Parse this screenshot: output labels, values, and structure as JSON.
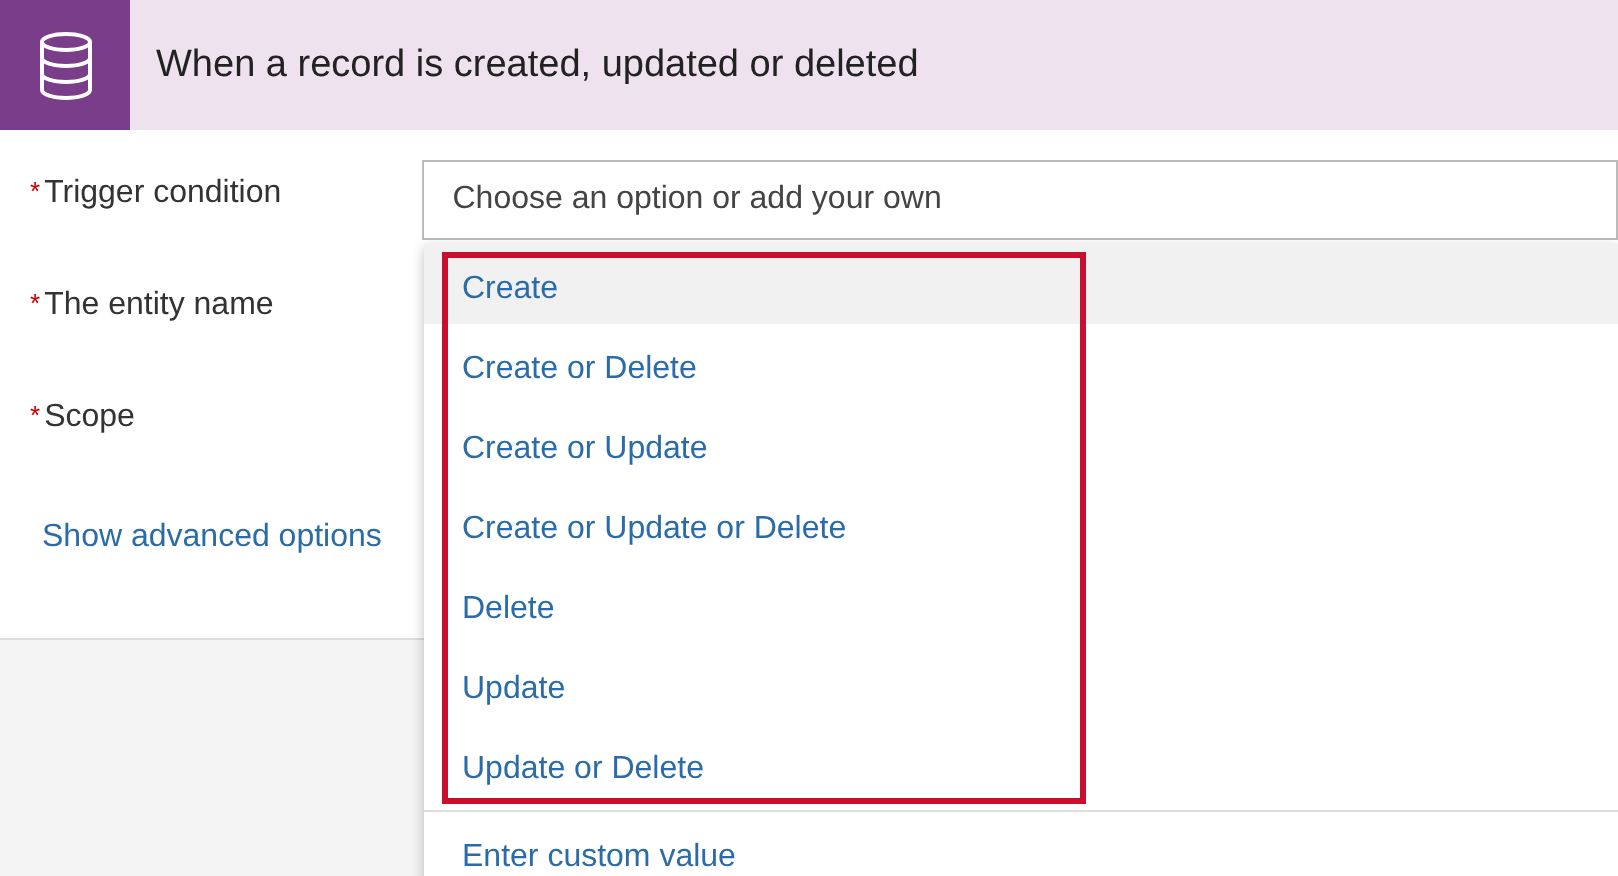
{
  "header": {
    "title": "When a record is created, updated or deleted"
  },
  "fields": [
    {
      "label": "Trigger condition",
      "required_mark": "*",
      "placeholder": "Choose an option or add your own"
    },
    {
      "label": "The entity name",
      "required_mark": "*"
    },
    {
      "label": "Scope",
      "required_mark": "*"
    }
  ],
  "advanced_link": "Show advanced options",
  "dropdown": {
    "highlight_frame": true,
    "options": [
      {
        "label": "Create",
        "selected": true
      },
      {
        "label": "Create or Delete",
        "selected": false
      },
      {
        "label": "Create or Update",
        "selected": false
      },
      {
        "label": "Create or Update or Delete",
        "selected": false
      },
      {
        "label": "Delete",
        "selected": false
      },
      {
        "label": "Update",
        "selected": false
      },
      {
        "label": "Update or Delete",
        "selected": false
      }
    ],
    "custom_entry": "Enter custom value"
  }
}
